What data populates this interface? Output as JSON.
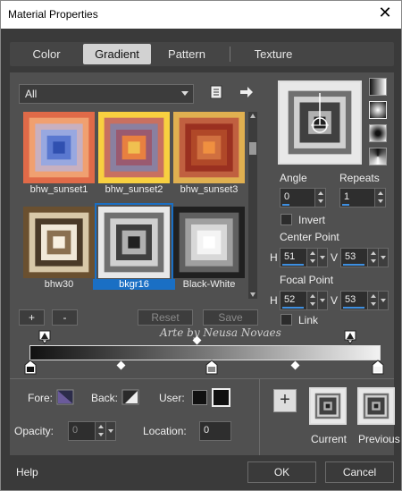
{
  "window": {
    "title": "Material Properties",
    "close_glyph": "✕"
  },
  "tabs": [
    {
      "label": "Color",
      "active": false
    },
    {
      "label": "Gradient",
      "active": true
    },
    {
      "label": "Pattern",
      "active": false
    },
    {
      "label": "Texture",
      "active": false
    }
  ],
  "gradient_select": {
    "value": "All"
  },
  "gradients": [
    {
      "label": "bhw_sunset1",
      "colors": [
        "#e06a48",
        "#f0a070",
        "#c8b0c0",
        "#98a8e0",
        "#5a78d0",
        "#3050b0"
      ],
      "selected": false
    },
    {
      "label": "bhw_sunset2",
      "colors": [
        "#f8d040",
        "#c87060",
        "#8a80a0",
        "#9a5a70",
        "#e88040",
        "#f0c050"
      ],
      "selected": false
    },
    {
      "label": "bhw_sunset3",
      "colors": [
        "#e0b050",
        "#c06040",
        "#9a3020",
        "#b04828",
        "#d07040",
        "#f09040"
      ],
      "selected": false
    },
    {
      "label": "bhw30",
      "colors": [
        "#6a5030",
        "#d8c8a8",
        "#4a3a28",
        "#f0e8d8",
        "#8a7050",
        "#f8f0e0"
      ],
      "selected": false
    },
    {
      "label": "bkgr16",
      "colors": [
        "#e8e8e8",
        "#707070",
        "#d0d0d0",
        "#404040",
        "#b0b0b0",
        "#202020"
      ],
      "selected": true
    },
    {
      "label": "Black-White",
      "colors": [
        "#202020",
        "#606060",
        "#a0a0a0",
        "#d8d8d8",
        "#f4f4f4",
        "#ffffff"
      ],
      "selected": false
    }
  ],
  "angle": {
    "label": "Angle",
    "value": "0"
  },
  "repeats": {
    "label": "Repeats",
    "value": "1"
  },
  "invert": {
    "label": "Invert"
  },
  "center_point": {
    "label": "Center Point",
    "h_label": "H",
    "h": "51",
    "v_label": "V",
    "v": "53"
  },
  "focal_point": {
    "label": "Focal Point",
    "h_label": "H",
    "h": "52",
    "v_label": "V",
    "v": "53"
  },
  "link": {
    "label": "Link"
  },
  "buttons": {
    "add": "+",
    "remove": "-",
    "reset": "Reset",
    "save": "Save",
    "ok": "OK",
    "cancel": "Cancel",
    "help": "Help",
    "add_swatch": "+"
  },
  "watermark": "Arte by Neusa Novaes",
  "fore": {
    "label": "Fore:"
  },
  "back": {
    "label": "Back:"
  },
  "user": {
    "label": "User:"
  },
  "opacity": {
    "label": "Opacity:",
    "value": "0"
  },
  "location": {
    "label": "Location:",
    "value": "0"
  },
  "current": {
    "label": "Current"
  },
  "previous": {
    "label": "Previous"
  },
  "colors": {
    "accent": "#1a6fc4",
    "background": "#505050",
    "frame": "#3a3a3a"
  }
}
